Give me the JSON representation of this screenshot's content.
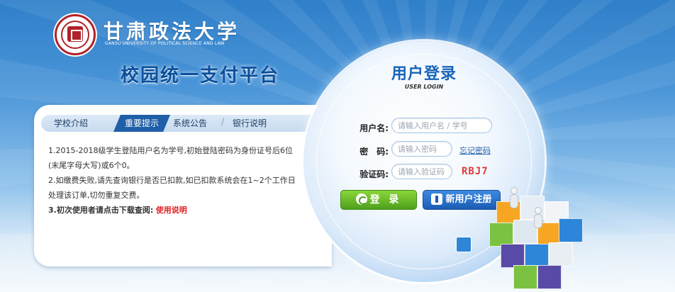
{
  "header": {
    "university_name": "甘肃政法大学",
    "university_name_en": "GANSU UNIVERSITY OF POLITICAL SCIENCE AND LAW",
    "platform_title": "校园统一支付平台"
  },
  "tabs": [
    {
      "label": "学校介绍",
      "active": false
    },
    {
      "label": "重要提示",
      "active": true
    },
    {
      "label": "系统公告",
      "active": false
    },
    {
      "label": "银行说明",
      "active": false
    }
  ],
  "notice": {
    "line1": "1.2015-2018级学生登陆用户名为学号,初始登陆密码为身份证号后6位(末尾字母大写)或6个0。",
    "line2": "2.如缴费失败,请先查询银行是否已扣款,如已扣款系统会在1~2个工作日处理该订单,切勿重复交费。",
    "line3_prefix": "3.初次使用者请点击下载查阅:",
    "line3_link": "使用说明"
  },
  "login": {
    "title": "用户登录",
    "subtitle": "USER LOGIN",
    "username_label": "用户名:",
    "username_placeholder": "请输入用户名 / 学号",
    "password_label": "密　码:",
    "password_placeholder": "请输入密码",
    "forgot_label": "忘记密码",
    "captcha_label": "验证码:",
    "captcha_placeholder": "请输入验证码",
    "captcha_code": "RBJ7",
    "login_button": "登 录",
    "register_button": "新用户注册"
  },
  "colors": {
    "brand_blue": "#1764b8",
    "tab_active": "#1f5fa8",
    "login_green": "#4ea01b",
    "seal_red": "#b0232a",
    "link_red": "#e02020"
  }
}
